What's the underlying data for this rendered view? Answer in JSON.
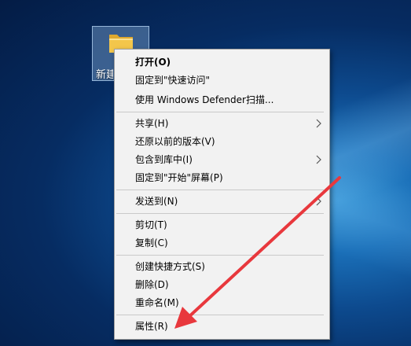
{
  "desktop": {
    "icon_label": "新建文件夹"
  },
  "context_menu": {
    "items": [
      {
        "label": "打开(O)"
      },
      {
        "label": "固定到\"快速访问\""
      },
      {
        "label": "使用 Windows Defender扫描..."
      },
      {
        "label": "共享(H)"
      },
      {
        "label": "还原以前的版本(V)"
      },
      {
        "label": "包含到库中(I)"
      },
      {
        "label": "固定到\"开始\"屏幕(P)"
      },
      {
        "label": "发送到(N)"
      },
      {
        "label": "剪切(T)"
      },
      {
        "label": "复制(C)"
      },
      {
        "label": "创建快捷方式(S)"
      },
      {
        "label": "删除(D)"
      },
      {
        "label": "重命名(M)"
      },
      {
        "label": "属性(R)"
      }
    ]
  },
  "colors": {
    "arrow": "#e8383d",
    "menu_bg": "#f2f2f2",
    "folder": "#f3c64b"
  }
}
